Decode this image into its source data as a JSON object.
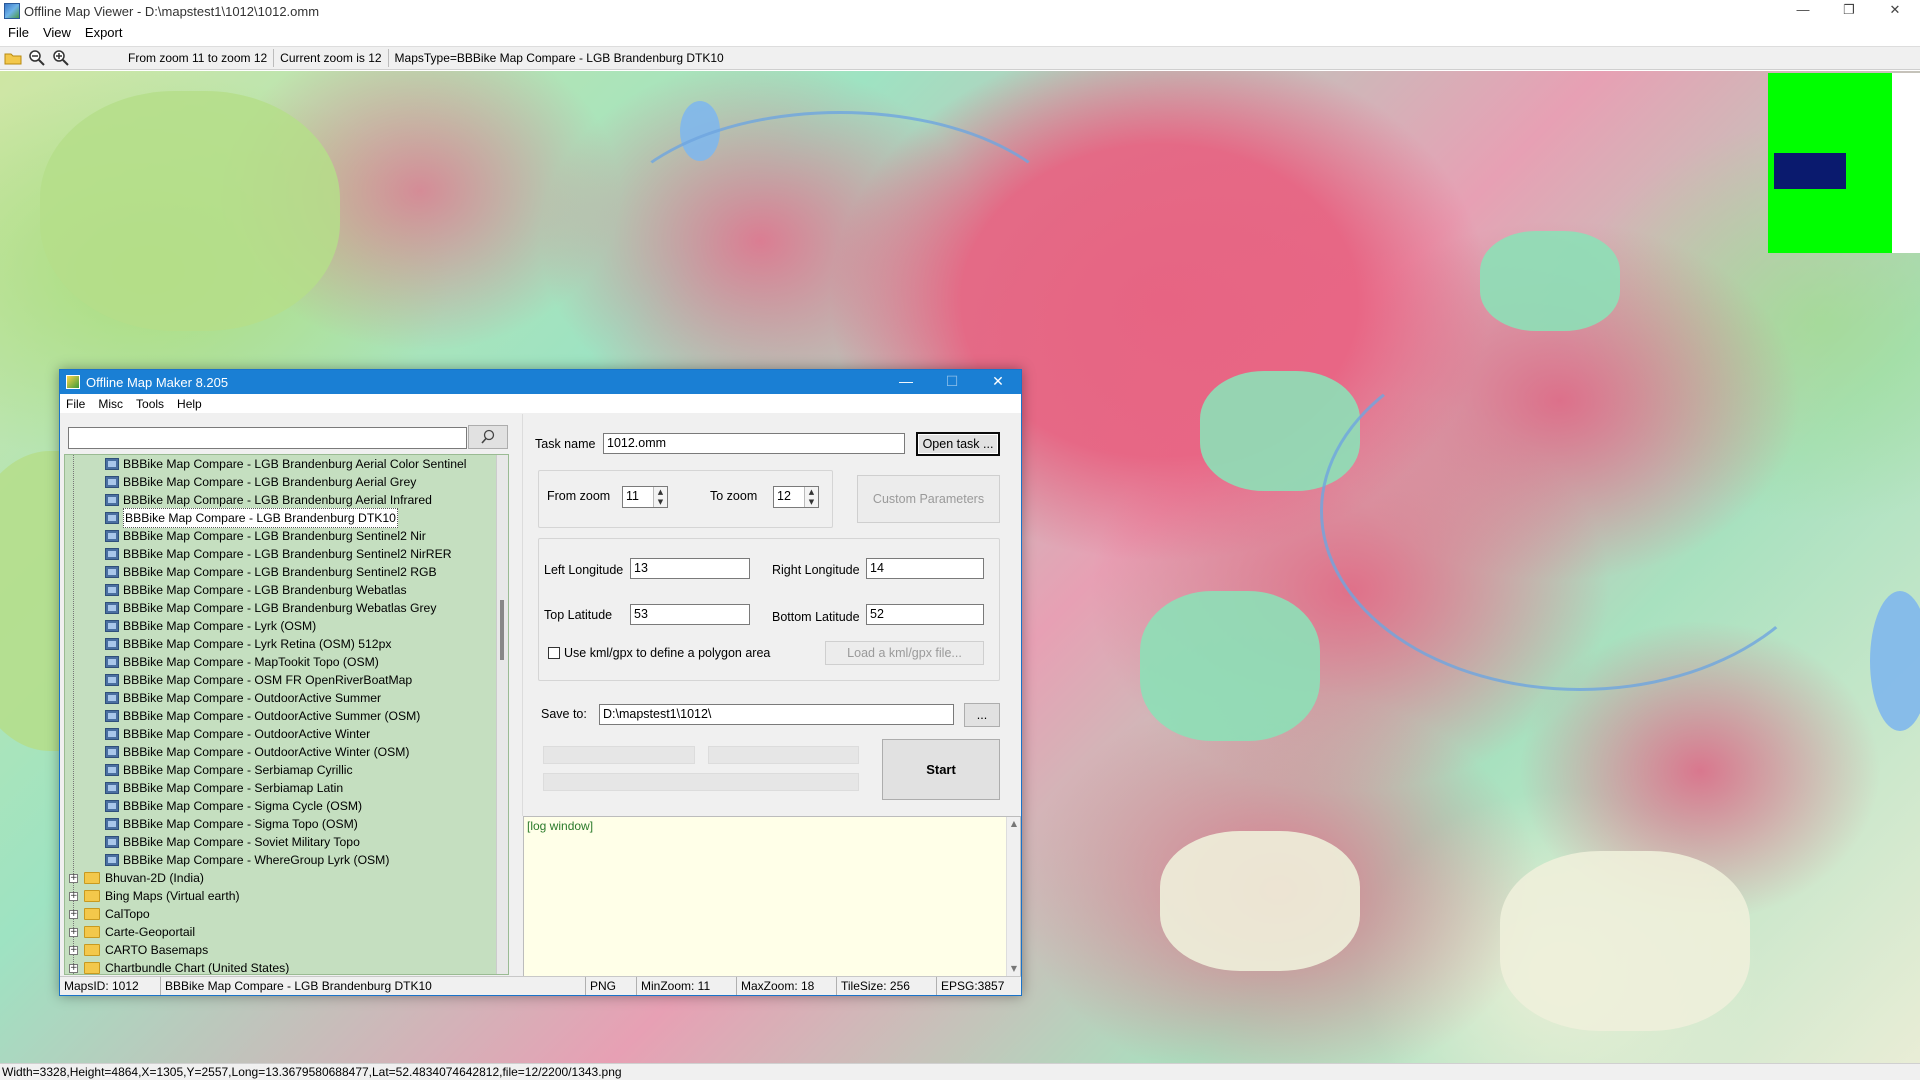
{
  "window": {
    "title": "Offline Map Viewer - D:\\mapstest1\\1012\\1012.omm",
    "menu": [
      "File",
      "View",
      "Export"
    ],
    "controls": {
      "minimize": "—",
      "restore": "❐",
      "close": "✕"
    }
  },
  "toolbar": {
    "icons": [
      "open-folder-icon",
      "zoom-out-icon",
      "zoom-in-icon"
    ],
    "zoom_range": "From zoom 11 to zoom 12",
    "current_zoom": "Current zoom is 12",
    "maps_type": "MapsType=BBBike Map Compare - LGB Brandenburg DTK10"
  },
  "map": {
    "overview_colors": {
      "background": "#00ff00",
      "viewport": "#0a1a6e"
    }
  },
  "statusbar": {
    "text": "Width=3328,Height=4864,X=1305,Y=2557,Long=13.3679580688477,Lat=52.4834074642812,file=12/2200/1343.png"
  },
  "dialog": {
    "title": "Offline Map Maker 8.205",
    "controls": {
      "minimize": "—",
      "maximize": "☐",
      "close": "✕"
    },
    "menu": [
      "File",
      "Misc",
      "Tools",
      "Help"
    ],
    "search": {
      "placeholder": "",
      "value": ""
    },
    "tree": {
      "leaves": [
        {
          "label": "BBBike Map Compare - LGB Brandenburg Aerial Color Sentinel",
          "selected": false
        },
        {
          "label": "BBBike Map Compare - LGB Brandenburg Aerial Grey",
          "selected": false
        },
        {
          "label": "BBBike Map Compare - LGB Brandenburg Aerial Infrared",
          "selected": false
        },
        {
          "label": "BBBike Map Compare - LGB Brandenburg DTK10",
          "selected": true
        },
        {
          "label": "BBBike Map Compare - LGB Brandenburg Sentinel2 Nir",
          "selected": false
        },
        {
          "label": "BBBike Map Compare - LGB Brandenburg Sentinel2 NirRER",
          "selected": false
        },
        {
          "label": "BBBike Map Compare - LGB Brandenburg Sentinel2 RGB",
          "selected": false
        },
        {
          "label": "BBBike Map Compare - LGB Brandenburg Webatlas",
          "selected": false
        },
        {
          "label": "BBBike Map Compare - LGB Brandenburg Webatlas Grey",
          "selected": false
        },
        {
          "label": "BBBike Map Compare - Lyrk (OSM)",
          "selected": false
        },
        {
          "label": "BBBike Map Compare - Lyrk Retina (OSM) 512px",
          "selected": false
        },
        {
          "label": "BBBike Map Compare - MapTookit Topo (OSM)",
          "selected": false
        },
        {
          "label": "BBBike Map Compare - OSM FR OpenRiverBoatMap",
          "selected": false
        },
        {
          "label": "BBBike Map Compare - OutdoorActive Summer",
          "selected": false
        },
        {
          "label": "BBBike Map Compare - OutdoorActive Summer (OSM)",
          "selected": false
        },
        {
          "label": "BBBike Map Compare - OutdoorActive Winter",
          "selected": false
        },
        {
          "label": "BBBike Map Compare - OutdoorActive Winter (OSM)",
          "selected": false
        },
        {
          "label": "BBBike Map Compare - Serbiamap Cyrillic",
          "selected": false
        },
        {
          "label": "BBBike Map Compare - Serbiamap Latin",
          "selected": false
        },
        {
          "label": "BBBike Map Compare - Sigma Cycle (OSM)",
          "selected": false
        },
        {
          "label": "BBBike Map Compare - Sigma Topo (OSM)",
          "selected": false
        },
        {
          "label": "BBBike Map Compare - Soviet Military Topo",
          "selected": false
        },
        {
          "label": "BBBike Map Compare - WhereGroup Lyrk (OSM)",
          "selected": false
        }
      ],
      "folders": [
        {
          "label": "Bhuvan-2D (India)"
        },
        {
          "label": "Bing Maps (Virtual earth)"
        },
        {
          "label": "CalTopo"
        },
        {
          "label": "Carte-Geoportail"
        },
        {
          "label": "CARTO Basemaps"
        },
        {
          "label": "Chartbundle Chart (United States)"
        }
      ],
      "expander_symbol": "+"
    },
    "task": {
      "name_label": "Task name",
      "name_value": "1012.omm",
      "open_button": "Open task ...",
      "from_zoom_label": "From zoom",
      "from_zoom_value": "11",
      "to_zoom_label": "To zoom",
      "to_zoom_value": "12",
      "custom_params_button": "Custom Parameters",
      "left_lon_label": "Left Longitude",
      "left_lon_value": "13",
      "right_lon_label": "Right Longitude",
      "right_lon_value": "14",
      "top_lat_label": "Top Latitude",
      "top_lat_value": "53",
      "bottom_lat_label": "Bottom Latitude",
      "bottom_lat_value": "52",
      "kml_checkbox_label": "Use kml/gpx to define a polygon area",
      "kml_checked": false,
      "load_kml_button": "Load a kml/gpx file...",
      "save_to_label": "Save to:",
      "save_to_value": "D:\\mapstest1\\1012\\",
      "browse_button": "...",
      "start_button": "Start"
    },
    "log": {
      "text": "[log window]"
    },
    "status": {
      "maps_id": "MapsID: 1012",
      "maps_name": "BBBike Map Compare - LGB Brandenburg DTK10",
      "format": "PNG",
      "min_zoom": "MinZoom: 11",
      "max_zoom": "MaxZoom: 18",
      "tile_size": "TileSize: 256",
      "epsg": "EPSG:3857"
    }
  }
}
